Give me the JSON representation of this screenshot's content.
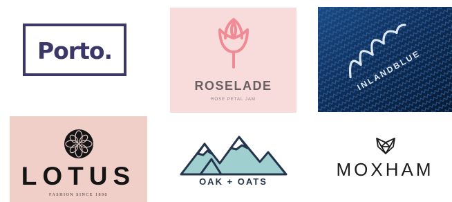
{
  "logos": [
    {
      "brand": "Porto.",
      "tagline": "",
      "colors": {
        "ink": "#3b3768",
        "background": "#ffffff"
      }
    },
    {
      "brand": "ROSELADE",
      "tagline": "ROSE PETAL JAM",
      "icon": "rose-icon",
      "colors": {
        "ink": "#6a5f61",
        "accent": "#f08b95",
        "background": "#f8dcdc"
      }
    },
    {
      "brand": "INLANDBLUE",
      "tagline": "",
      "icon": "mountain-line-icon",
      "colors": {
        "ink": "#dce8f4",
        "background": "#0d2646"
      }
    },
    {
      "brand": "LOTUS",
      "tagline": "FASHION SINCE 1890",
      "icon": "lotus-emblem-icon",
      "colors": {
        "ink": "#141414",
        "background": "#f1cfc9"
      }
    },
    {
      "brand": "OAK + OATS",
      "tagline": "",
      "icon": "mountains-icon",
      "colors": {
        "ink": "#24344c",
        "accent": "#9fcfcf",
        "background": "#ffffff"
      }
    },
    {
      "brand": "MOXHAM",
      "tagline": "",
      "icon": "geometric-fox-icon",
      "colors": {
        "ink": "#1c1c1c",
        "background": "#ffffff"
      }
    }
  ]
}
